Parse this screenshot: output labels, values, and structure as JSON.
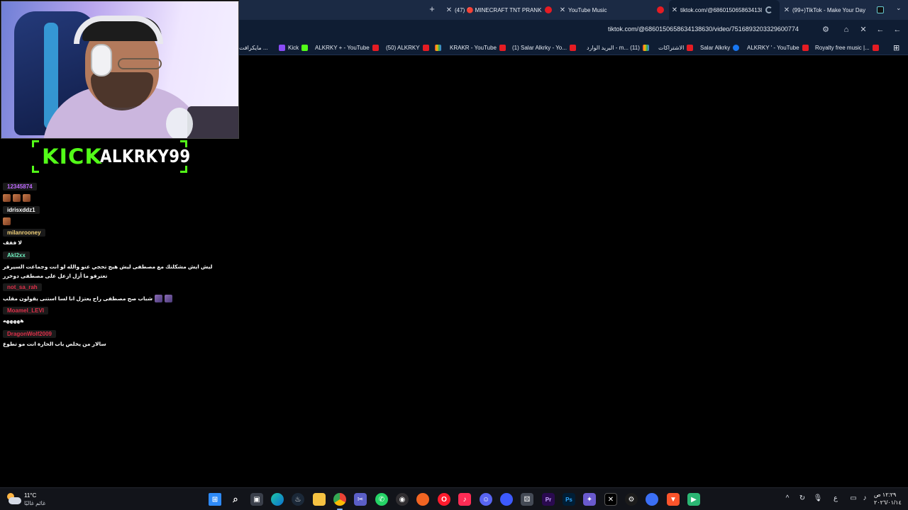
{
  "browser": {
    "tabs": [
      {
        "label": "(47) 🔴 MINECRAFT TNT PRANK",
        "icon": "youtube-icon"
      },
      {
        "label": "YouTube Music",
        "icon": "youtube-music-icon"
      },
      {
        "label": "tiktok.com/@6860150658634138630",
        "icon": "loading-icon",
        "active": true
      },
      {
        "label": "(99+)TikTok - Make Your Day",
        "icon": "tiktok-icon"
      }
    ],
    "url": "tiktok.com/@6860150658634138630/video/7516893203329600774",
    "bookmarks": [
      {
        "label": "Royalty free music |...",
        "icon": "red"
      },
      {
        "label": "ALKRKY ' - YouTube",
        "icon": "blue"
      },
      {
        "label": "Salar Alkrky",
        "icon": "red"
      },
      {
        "label": "الاشتراكات",
        "icon": "gray"
      },
      {
        "label": "البريد الوارد - m... (11)",
        "icon": "red"
      },
      {
        "label": "(1) Salar Alkrky - Yo...",
        "icon": "red"
      },
      {
        "label": "KRAKR - YouTube",
        "icon": "rainbow"
      },
      {
        "label": "(50) ALKRKY",
        "icon": "red"
      },
      {
        "label": "ALKRKY + - YouTube",
        "icon": "green"
      },
      {
        "label": "Kick",
        "icon": "purple"
      },
      {
        "label": "مايكرافت ...",
        "icon": ""
      }
    ]
  },
  "stream": {
    "platform_logo": "KICK",
    "channel_name": "ALKRKY99"
  },
  "chat": [
    {
      "user": "12345874",
      "color": "#c06bff",
      "text": "",
      "emotes": 3
    },
    {
      "user": "idrisxddz1",
      "color": "#ffffff",
      "text": "",
      "emotes": 1
    },
    {
      "user": "milanrooney",
      "color": "#f4d27a",
      "text": "لا ففف",
      "emotes": 0
    },
    {
      "user": "Akl2xx",
      "color": "#6ff0c0",
      "text": "ليش ايش مشكلتك مع مصطفى ليش هيج تحجي عنو والله لو انت وجماعت السيرفر تعترفو ما أزل ازعل على مصطفى دوخرر",
      "emotes": 0
    },
    {
      "user": "not_sa_rah",
      "color": "#e0304a",
      "text": "شباب صح مصطفى راح يعتزل انا لسا استنى يقولون مقلب",
      "emotes": 2
    },
    {
      "user": "Moamel_LEVI",
      "color": "#e0304a",
      "text": "هههههه",
      "emotes": 0
    },
    {
      "user": "DragonWolf2009",
      "color": "#e0304a",
      "text": "سالار من يخلص باب الحارة انت مو تطوع",
      "emotes": 0
    }
  ],
  "taskbar": {
    "weather_temp": "11°C",
    "weather_desc": "غائم غالبًا",
    "time": "١٢:٢٩ ص",
    "date": "٢٠٢٦/٠١/١٤"
  }
}
